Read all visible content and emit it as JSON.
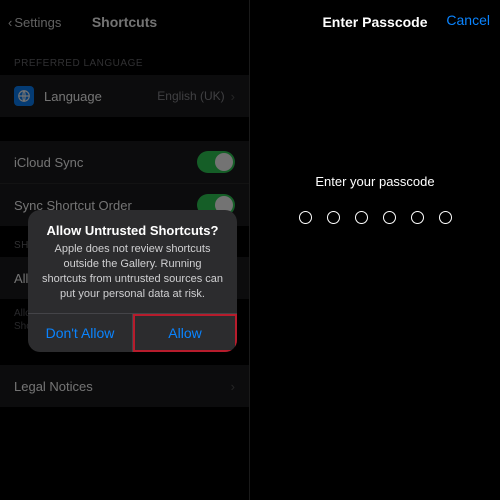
{
  "left": {
    "back_label": "Settings",
    "title": "Shortcuts",
    "sections": {
      "preferred_language": "PREFERRED LANGUAGE",
      "sharing": "SHARING"
    },
    "rows": {
      "language_label": "Language",
      "language_value": "English (UK)",
      "icloud_sync": "iCloud Sync",
      "sync_order": "Sync Shortcut Order",
      "allow_untrusted": "Allow Untrusted Shortcuts",
      "legal": "Legal Notices"
    },
    "footer": "Allow shortcuts from outside the Gallery. About Shortcuts Security",
    "alert": {
      "title": "Allow Untrusted Shortcuts?",
      "message": "Apple does not review shortcuts outside the Gallery. Running shortcuts from untrusted sources can put your personal data at risk.",
      "dont_allow": "Don't Allow",
      "allow": "Allow"
    }
  },
  "right": {
    "title": "Enter Passcode",
    "cancel": "Cancel",
    "prompt": "Enter your passcode"
  }
}
